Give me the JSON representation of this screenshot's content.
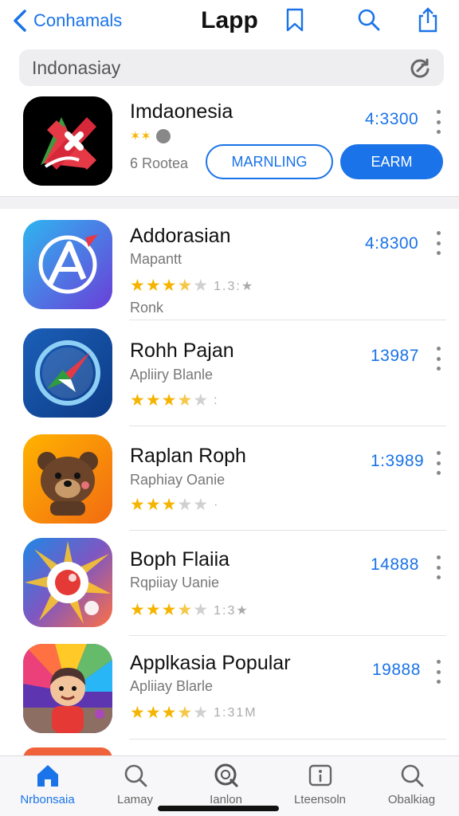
{
  "header": {
    "back_label": "Conhamals",
    "title": "Lapp"
  },
  "search": {
    "value": "Indonasiay"
  },
  "featured": {
    "name": "Imdaonesia",
    "badge_text": "✶✶",
    "meta_text": "6 Rootea",
    "price": "4:3300",
    "button_outline_label": "MARNLING",
    "button_solid_label": "EARM"
  },
  "apps": [
    {
      "name": "Addorasian",
      "subtitle": "Mapantt",
      "price": "4:8300",
      "rating": 3.5,
      "rating_count": "1.3:★",
      "extra": "Ronk"
    },
    {
      "name": "Rohh Pajan",
      "subtitle": "Apliiry Blanle",
      "price": "13987",
      "rating": 3.5,
      "rating_count": ":",
      "extra": ""
    },
    {
      "name": "Raplan Roph",
      "subtitle": "Raphiay Oanie",
      "price": "1:3989",
      "rating": 3,
      "rating_count": "·",
      "extra": ""
    },
    {
      "name": "Boph Flaiia",
      "subtitle": "Rqpiiay Uanie",
      "price": "14888",
      "rating": 3.5,
      "rating_count": "1:3★",
      "extra": ""
    },
    {
      "name": "Applkasia Popular",
      "subtitle": "Apliiay Blarle",
      "price": "19888",
      "rating": 3.5,
      "rating_count": "1:31M",
      "extra": ""
    }
  ],
  "tabs": [
    {
      "label": "Nrbonsaia",
      "icon": "home-icon",
      "active": true
    },
    {
      "label": "Lamay",
      "icon": "search-icon",
      "active": false
    },
    {
      "label": "Ianlon",
      "icon": "magnifier-icon",
      "active": false
    },
    {
      "label": "Lteensoln",
      "icon": "info-icon",
      "active": false
    },
    {
      "label": "Obalkiag",
      "icon": "search-icon",
      "active": false
    }
  ],
  "colors": {
    "accent": "#1a73e8",
    "star": "#f5b400"
  }
}
